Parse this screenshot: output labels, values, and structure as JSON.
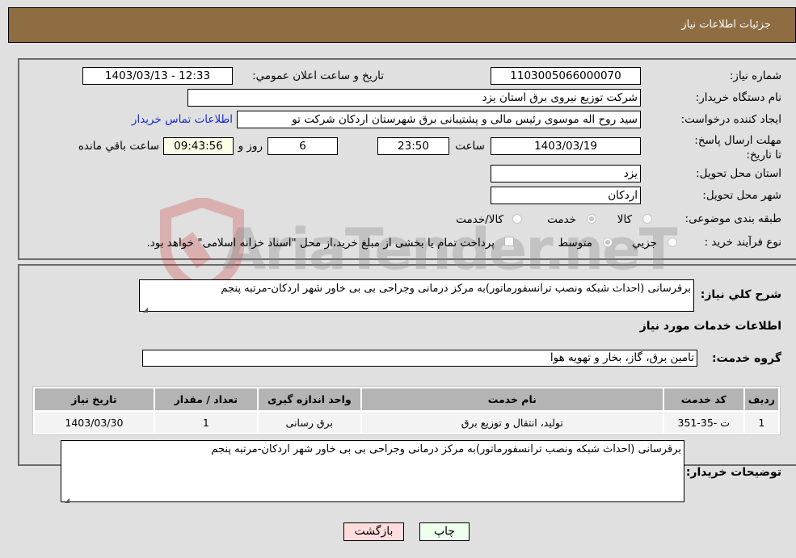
{
  "header": {
    "title": "جزئیات اطلاعات نیاز"
  },
  "form": {
    "need_number": {
      "label": "شماره نیاز:",
      "value": "1103005066000070"
    },
    "announce_datetime": {
      "label": "تاریخ و ساعت اعلان عمومي:",
      "value": "1403/03/13 - 12:33"
    },
    "buyer_org": {
      "label": "نام دستگاه خريدار:",
      "value": "شرکت توزیع نیروی برق استان یزد"
    },
    "requester": {
      "label": "ایجاد کننده درخواست:",
      "value": "سید روح اله  موسوی  رئیس مالی و پشتیبانی برق شهرستان اردکان  شرکت تو"
    },
    "buyer_contact_link": "اطلاعات تماس خریدار",
    "deadline": {
      "label": "مهلت ارسال پاسخ: تا تاریخ:",
      "date": "1403/03/19",
      "time_label": "ساعت",
      "time": "23:50",
      "days": "6",
      "days_label": "روز و",
      "remaining": "09:43:56",
      "remaining_label": "ساعت باقي مانده"
    },
    "province": {
      "label": "استان محل تحویل:",
      "value": "یزد"
    },
    "city": {
      "label": "شهر محل تحویل:",
      "value": "اردکان"
    },
    "category": {
      "label": "طبقه بندی موضوعی:",
      "options": [
        "کالا",
        "خدمت",
        "کالا/خدمت"
      ],
      "selected": "خدمت"
    },
    "purchase_type": {
      "label": "نوع فرآیند خرید :",
      "options": [
        "جزيي",
        "متوسط"
      ],
      "selected": "متوسط",
      "treasury_checkbox_label": "پرداخت تمام یا بخشی از مبلغ خرید،از محل \"اسناد خزانه اسلامی\" خواهد بود.",
      "treasury_checked": false
    }
  },
  "summary": {
    "label": "شرح کلي نياز:",
    "value": "برقرسانی (احداث شبکه ونصب ترانسفورماتور)به مرکز درمانی وجراحی بی بی خاور شهر اردکان-مرتبه پنجم"
  },
  "services_section": {
    "title": "اطلاعات خدمات مورد نياز",
    "group_label": "گروه خدمت:",
    "group_value": "تامین برق، گاز، بخار و تهویه هوا",
    "table": {
      "headers": [
        "رديف",
        "کد خدمت",
        "نام خدمت",
        "واحد اندازه گيری",
        "تعداد / مقدار",
        "تاریخ نیاز"
      ],
      "rows": [
        [
          "1",
          "ت -35-351",
          "تولید، انتقال و توزیع برق",
          "برق رسانی",
          "1",
          "1403/03/30"
        ]
      ]
    }
  },
  "buyer_notes": {
    "label": "توضیحات خریدار:",
    "value": "برقرسانی (احداث شبکه ونصب ترانسفورماتور)به مرکز درمانی وجراحی بی بی خاور شهر اردکان-مرتبه پنجم"
  },
  "buttons": {
    "print": "چاپ",
    "back": "بازگشت"
  },
  "colors": {
    "header_bg": "#8e6d43",
    "print_bg": "#eeffee",
    "back_bg": "#ffdddd",
    "link": "#1a2ccc"
  }
}
